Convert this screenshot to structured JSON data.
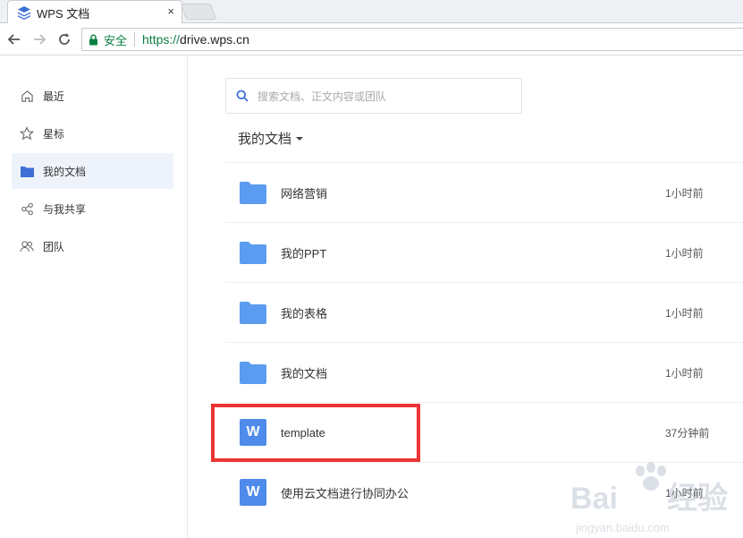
{
  "browser": {
    "tab_title": "WPS 文档",
    "tab_close": "×",
    "secure_label": "安全",
    "url_scheme": "https://",
    "url_host": "drive.wps.cn"
  },
  "sidebar": {
    "items": [
      {
        "label": "最近",
        "icon": "clock-icon"
      },
      {
        "label": "星标",
        "icon": "star-icon"
      },
      {
        "label": "我的文档",
        "icon": "folder-icon"
      },
      {
        "label": "与我共享",
        "icon": "share-icon"
      },
      {
        "label": "团队",
        "icon": "team-icon"
      }
    ],
    "active_index": 2
  },
  "search": {
    "placeholder": "搜索文档、正文内容或团队"
  },
  "breadcrumb": {
    "label": "我的文档"
  },
  "files": [
    {
      "name": "网络营销",
      "time": "1小时前",
      "type": "folder"
    },
    {
      "name": "我的PPT",
      "time": "1小时前",
      "type": "folder"
    },
    {
      "name": "我的表格",
      "time": "1小时前",
      "type": "folder"
    },
    {
      "name": "我的文档",
      "time": "1小时前",
      "type": "folder"
    },
    {
      "name": "template",
      "time": "37分钟前",
      "type": "wps-doc"
    },
    {
      "name": "使用云文档进行协同办公",
      "time": "1小时前",
      "type": "wps-doc"
    }
  ],
  "doc_icon_letter": "W",
  "colors": {
    "accent": "#4f8bea",
    "folder": "#5b9cf0",
    "highlight": "#ee3333",
    "secure_green": "#0b8043"
  }
}
